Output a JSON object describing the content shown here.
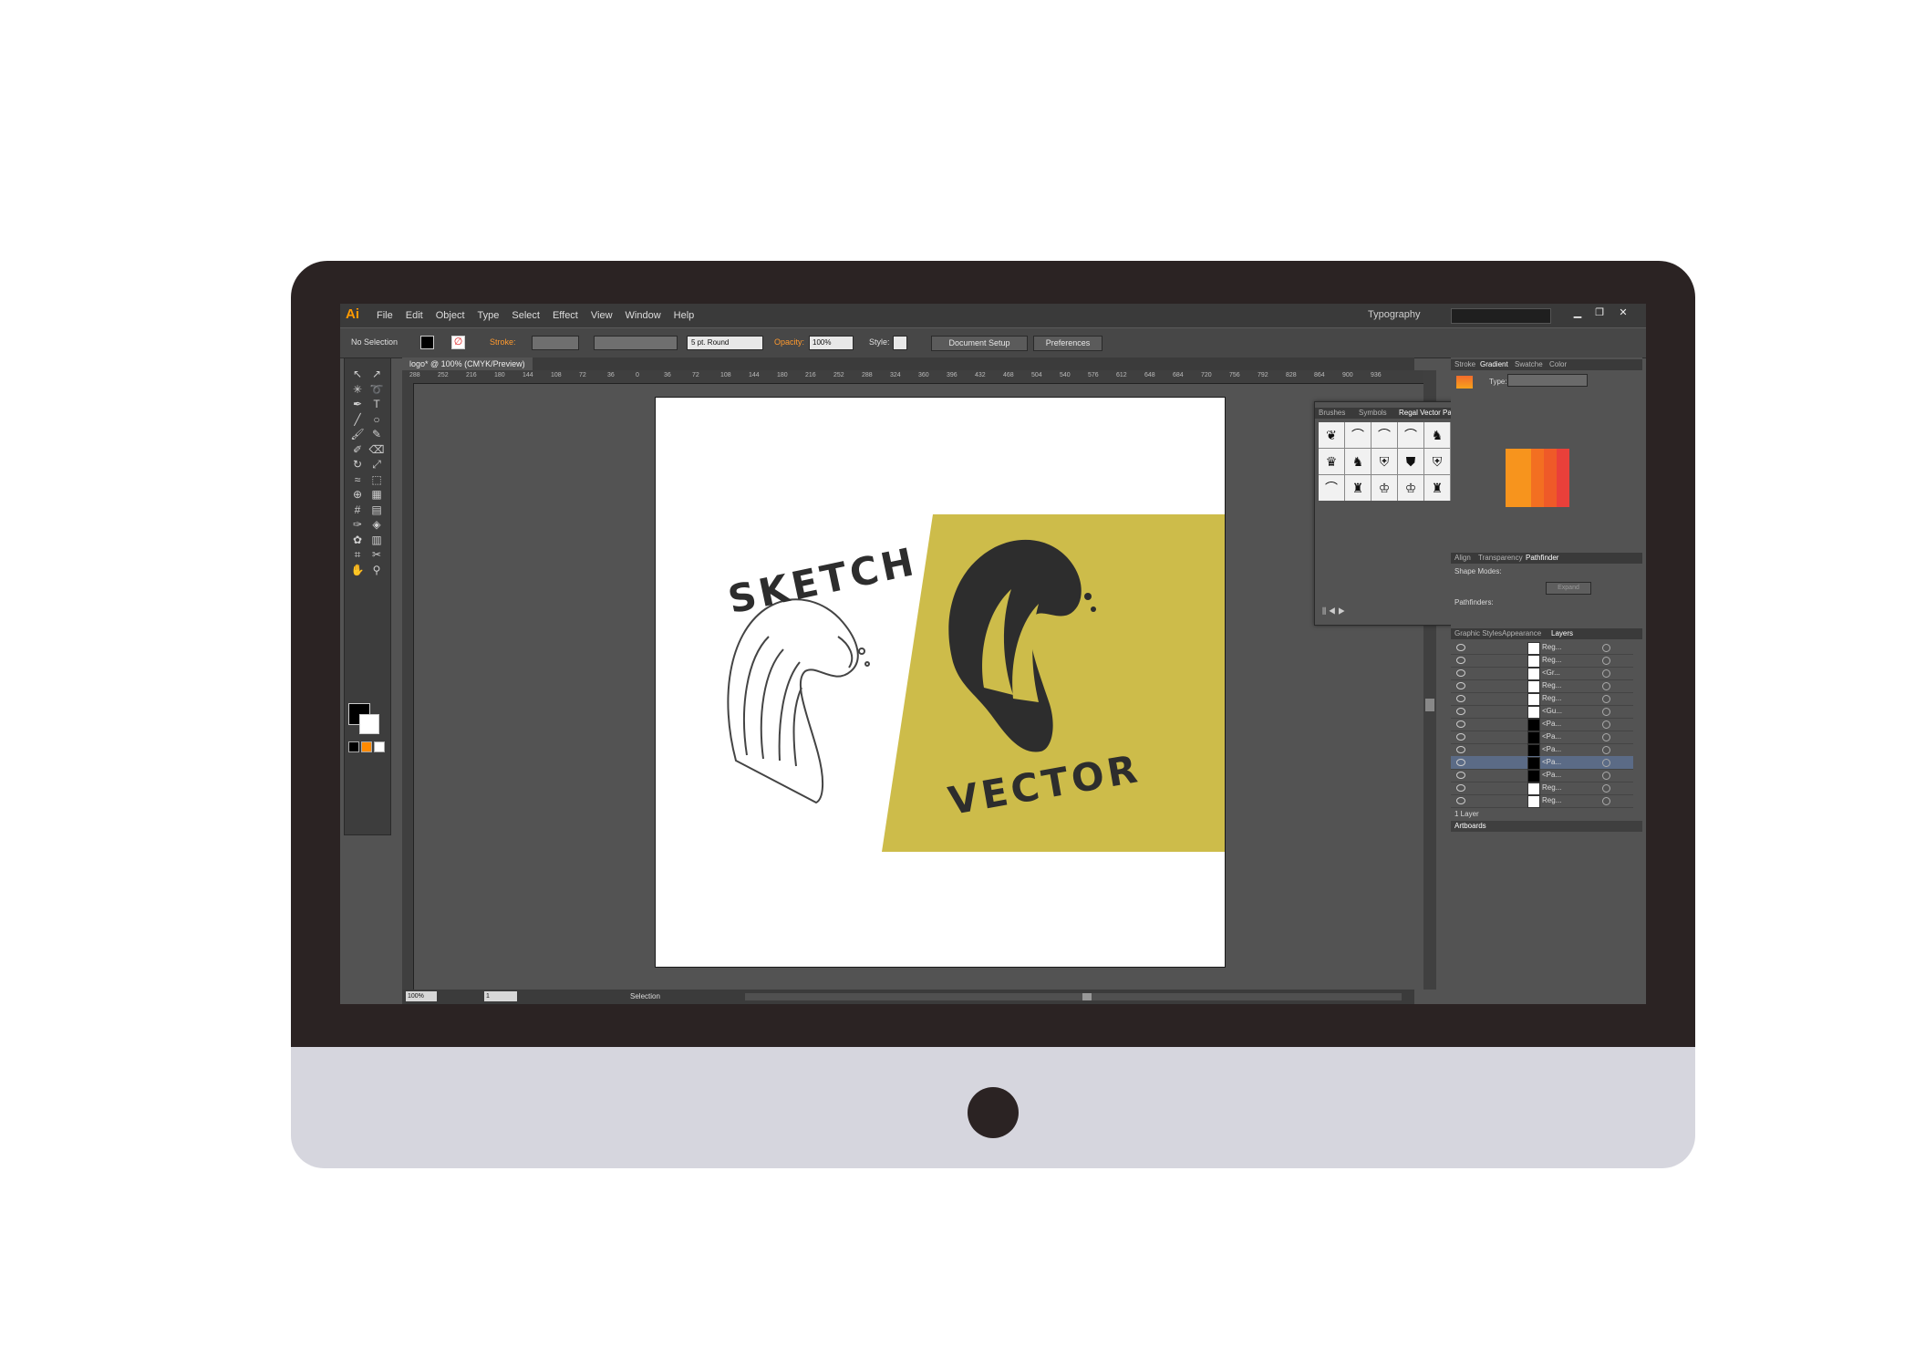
{
  "app": {
    "logo": "Ai",
    "workspace": "Typography"
  },
  "menu": [
    "File",
    "Edit",
    "Object",
    "Type",
    "Select",
    "Effect",
    "View",
    "Window",
    "Help"
  ],
  "control": {
    "selection": "No Selection",
    "stroke_label": "Stroke:",
    "brush": "5 pt. Round",
    "opacity_label": "Opacity:",
    "opacity_value": "100%",
    "style_label": "Style:",
    "doc_setup": "Document Setup",
    "preferences": "Preferences"
  },
  "document": {
    "tab": "logo* @ 100% (CMYK/Preview)"
  },
  "ruler_ticks": [
    "288",
    "252",
    "216",
    "180",
    "144",
    "108",
    "72",
    "36",
    "0",
    "36",
    "72",
    "108",
    "144",
    "180",
    "216",
    "252",
    "288",
    "324",
    "360",
    "396",
    "432",
    "468",
    "504",
    "540",
    "576",
    "612",
    "648",
    "684",
    "720",
    "756",
    "792",
    "828",
    "864",
    "900",
    "936"
  ],
  "artwork": {
    "word1": "SKETCH",
    "word2": "VECTOR",
    "accent": "#cdbc4a"
  },
  "status": {
    "zoom": "100%",
    "artboard": "1",
    "tool": "Selection"
  },
  "brushes_panel": {
    "tabs": [
      "Brushes",
      "Symbols",
      "Regal Vector Pack"
    ]
  },
  "gradient_panel": {
    "tabs": [
      "Stroke",
      "Gradient",
      "Swatche",
      "Color"
    ],
    "type_label": "Type:"
  },
  "pathfinder_panel": {
    "tabs": [
      "Align",
      "Transparency",
      "Pathfinder"
    ],
    "shape_modes": "Shape Modes:",
    "pathfinders": "Pathfinders:",
    "expand": "Expand"
  },
  "layers_panel": {
    "tabs": [
      "Graphic Styles",
      "Appearance",
      "Layers"
    ],
    "rows": [
      "Reg...",
      "Reg...",
      "<Gr...",
      "Reg...",
      "Reg...",
      "<Gu...",
      "<Pa...",
      "<Pa...",
      "<Pa...",
      "<Pa...",
      "<Pa...",
      "Reg...",
      "Reg..."
    ],
    "footer": "1 Layer"
  },
  "artboards_panel": {
    "title": "Artboards"
  }
}
